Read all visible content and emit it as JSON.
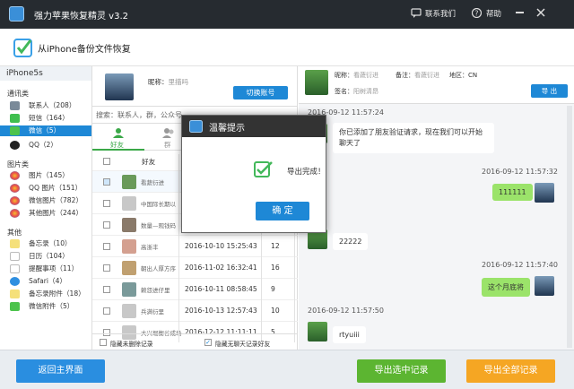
{
  "title_bar": {
    "app_title": "强力苹果恢复精灵 v3.2",
    "contact": "联系我们",
    "help": "帮助"
  },
  "subheader": {
    "title": "从iPhone备份文件恢复"
  },
  "sidebar": {
    "device": "iPhone5s",
    "groups": [
      {
        "label": "通讯类",
        "items": [
          {
            "label": "联系人（208）"
          },
          {
            "label": "短信（164）"
          },
          {
            "label": "微信（5）"
          },
          {
            "label": "QQ（2）"
          }
        ]
      },
      {
        "label": "图片类",
        "items": [
          {
            "label": "图片（145）"
          },
          {
            "label": "QQ 图片（151）"
          },
          {
            "label": "微信图片（782）"
          },
          {
            "label": "其他图片（244）"
          }
        ]
      },
      {
        "label": "其他",
        "items": [
          {
            "label": "备忘录（10）"
          },
          {
            "label": "日历（104）"
          },
          {
            "label": "提醒事项（11）"
          },
          {
            "label": "Safari（4）"
          },
          {
            "label": "备忘录附件（18）"
          },
          {
            "label": "微信附件（5）"
          }
        ]
      }
    ]
  },
  "center": {
    "nickname_label": "昵称：",
    "nickname_value": "里描吗",
    "switch_account": "切换账号",
    "search_placeholder": "搜索：联系人，群，公众号",
    "tab_friends": "好友",
    "tab_groups": "群",
    "col_friend": "好友",
    "rows": [
      {
        "name": "看蔬衍进",
        "date": "",
        "count": ""
      },
      {
        "name": "中国际长期以",
        "date": "",
        "count": ""
      },
      {
        "name": "数量—观钱码",
        "date": "",
        "count": ""
      },
      {
        "name": "高浙丰",
        "date": "2016-10-10 15:25:43",
        "count": "12"
      },
      {
        "name": "朝出人厚方序",
        "date": "2016-11-02 16:32:41",
        "count": "16"
      },
      {
        "name": "赖怨进仔里",
        "date": "2016-10-11 08:58:45",
        "count": "9"
      },
      {
        "name": "兵满衍里",
        "date": "2016-10-13 12:57:43",
        "count": "10"
      },
      {
        "name": "大兴堀衡谷成场",
        "date": "2016-12-12 11:11:11",
        "count": "5"
      }
    ],
    "hide_deleted": "隐藏未删除记录",
    "hide_no_chat": "隐藏无聊天记录好友"
  },
  "right": {
    "nickname_label": "昵称：",
    "nickname_value": "看蔬衍进",
    "remark_label": "备注：",
    "remark_value": "看蔬衍进",
    "region_label": "地区：",
    "region_value": "CN",
    "sign_label": "签名：",
    "sign_value": "阳树清昂",
    "export_btn": "导 出",
    "messages": [
      {
        "time": "2016-09-12 11:57:24",
        "text": "你已添加了朋友验证请求，现在我们可以开始聊天了",
        "side": "left"
      },
      {
        "time": "2016-09-12 11:57:32",
        "text": "111111",
        "side": "right"
      },
      {
        "time": "",
        "text": "22222",
        "side": "left"
      },
      {
        "time": "2016-09-12 11:57:40",
        "text": "这个月底将",
        "side": "right"
      },
      {
        "time": "2016-09-12 11:57:50",
        "text": "rtyuiii",
        "side": "left"
      }
    ]
  },
  "dialog": {
    "title": "温馨提示",
    "message": "导出完成！",
    "ok": "确 定"
  },
  "footer": {
    "back": "返回主界面",
    "export_selected": "导出选中记录",
    "export_all": "导出全部记录"
  },
  "colors": {
    "accent": "#1e88d6",
    "titlebar": "#262b30",
    "green_btn": "#5cb531",
    "orange_btn": "#f5a623",
    "bubble_green": "#9be36a"
  }
}
